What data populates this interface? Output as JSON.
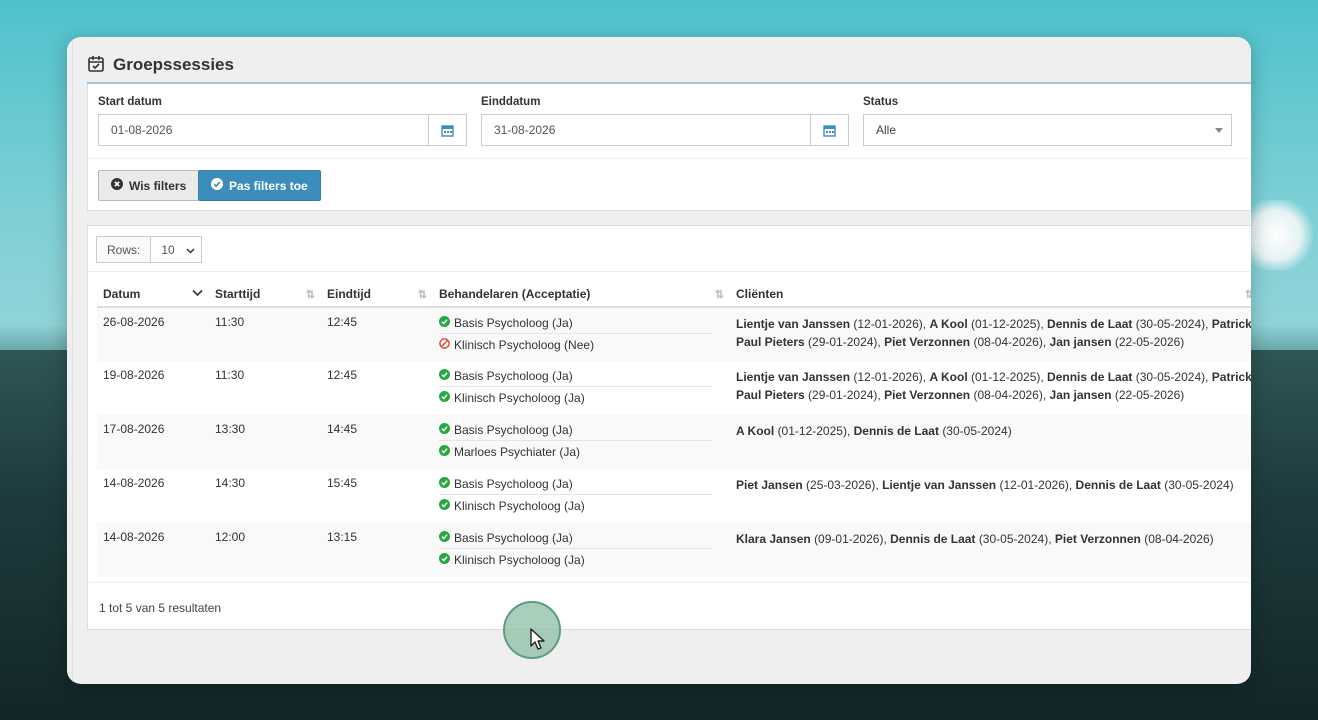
{
  "page": {
    "title": "Groepssessies"
  },
  "filters": {
    "start_label": "Start datum",
    "start_value": "01-08-2026",
    "end_label": "Einddatum",
    "end_value": "31-08-2026",
    "status_label": "Status",
    "status_value": "Alle",
    "clear_button": "Wis filters",
    "apply_button": "Pas filters toe"
  },
  "table": {
    "rows_label": "Rows:",
    "rows_value": "10",
    "columns": [
      "Datum",
      "Starttijd",
      "Eindtijd",
      "Behandelaren (Acceptatie)",
      "Cliënten"
    ],
    "rows": [
      {
        "date": "26-08-2026",
        "start": "11:30",
        "end": "12:45",
        "therapists": [
          {
            "label": "Basis Psycholoog (Ja)",
            "status": "accepted"
          },
          {
            "label": "Klinisch Psycholoog (Nee)",
            "status": "declined"
          }
        ],
        "clients": [
          {
            "name": "Lientje van Janssen",
            "date": "(12-01-2026)"
          },
          {
            "name": "A Kool",
            "date": "(01-12-2025)"
          },
          {
            "name": "Dennis de Laat",
            "date": "(30-05-2024)"
          },
          {
            "name": "Patrick Paul Pieters",
            "date": "(29-01-2024)"
          },
          {
            "name": "Piet Verzonnen",
            "date": "(08-04-2026)"
          },
          {
            "name": "Jan jansen",
            "date": "(22-05-2026)"
          }
        ]
      },
      {
        "date": "19-08-2026",
        "start": "11:30",
        "end": "12:45",
        "therapists": [
          {
            "label": "Basis Psycholoog (Ja)",
            "status": "accepted"
          },
          {
            "label": "Klinisch Psycholoog (Ja)",
            "status": "accepted"
          }
        ],
        "clients": [
          {
            "name": "Lientje van Janssen",
            "date": "(12-01-2026)"
          },
          {
            "name": "A Kool",
            "date": "(01-12-2025)"
          },
          {
            "name": "Dennis de Laat",
            "date": "(30-05-2024)"
          },
          {
            "name": "Patrick Paul Pieters",
            "date": "(29-01-2024)"
          },
          {
            "name": "Piet Verzonnen",
            "date": "(08-04-2026)"
          },
          {
            "name": "Jan jansen",
            "date": "(22-05-2026)"
          }
        ]
      },
      {
        "date": "17-08-2026",
        "start": "13:30",
        "end": "14:45",
        "therapists": [
          {
            "label": "Basis Psycholoog (Ja)",
            "status": "accepted"
          },
          {
            "label": "Marloes Psychiater (Ja)",
            "status": "accepted"
          }
        ],
        "clients": [
          {
            "name": "A Kool",
            "date": "(01-12-2025)"
          },
          {
            "name": "Dennis de Laat",
            "date": "(30-05-2024)"
          }
        ]
      },
      {
        "date": "14-08-2026",
        "start": "14:30",
        "end": "15:45",
        "therapists": [
          {
            "label": "Basis Psycholoog (Ja)",
            "status": "accepted"
          },
          {
            "label": "Klinisch Psycholoog (Ja)",
            "status": "accepted"
          }
        ],
        "clients": [
          {
            "name": "Piet Jansen",
            "date": "(25-03-2026)"
          },
          {
            "name": "Lientje van Janssen",
            "date": "(12-01-2026)"
          },
          {
            "name": "Dennis de Laat",
            "date": "(30-05-2024)"
          }
        ]
      },
      {
        "date": "14-08-2026",
        "start": "12:00",
        "end": "13:15",
        "therapists": [
          {
            "label": "Basis Psycholoog (Ja)",
            "status": "accepted"
          },
          {
            "label": "Klinisch Psycholoog (Ja)",
            "status": "accepted"
          }
        ],
        "clients": [
          {
            "name": "Klara Jansen",
            "date": "(09-01-2026)"
          },
          {
            "name": "Dennis de Laat",
            "date": "(30-05-2024)"
          },
          {
            "name": "Piet Verzonnen",
            "date": "(08-04-2026)"
          }
        ]
      }
    ],
    "footer": "1 tot 5 van 5 resultaten"
  },
  "colors": {
    "accepted": "#28a745",
    "declined": "#dd4b39",
    "primary": "#3c8dbc"
  }
}
